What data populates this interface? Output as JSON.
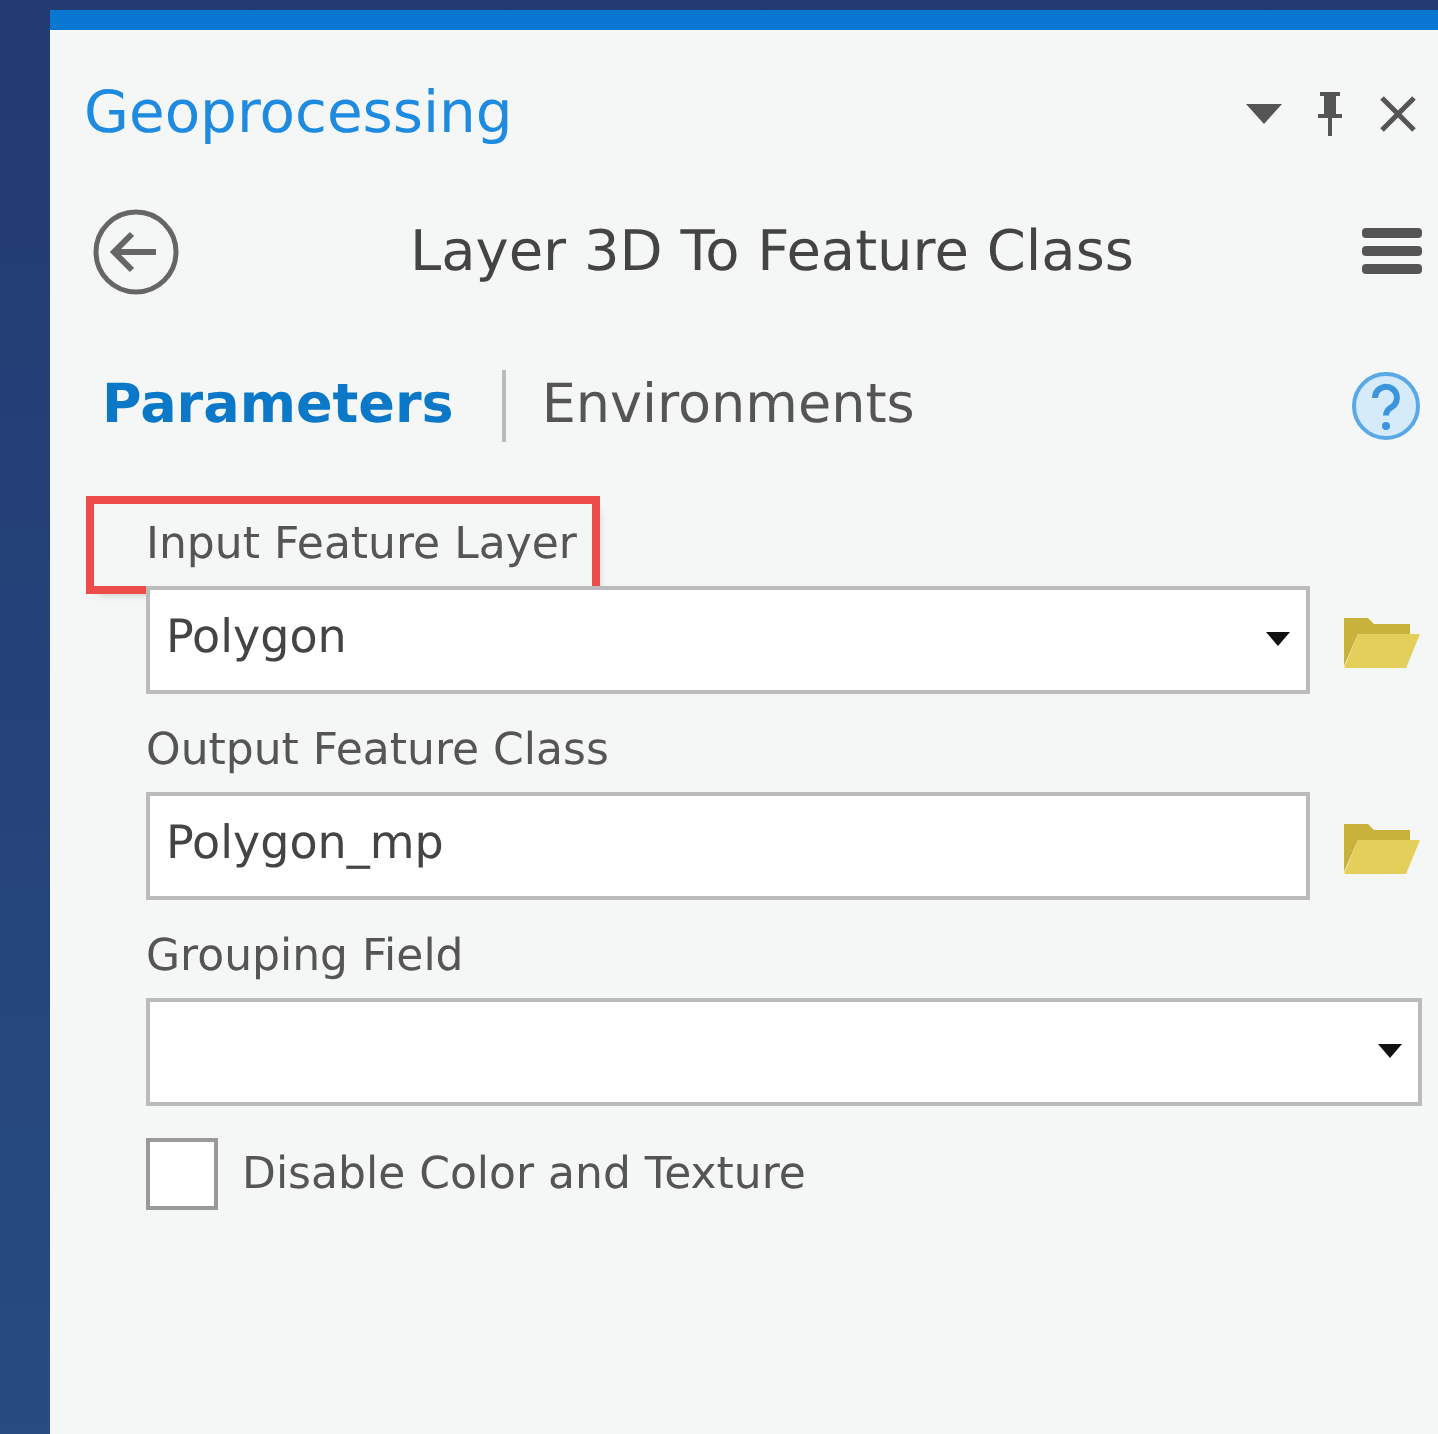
{
  "pane": {
    "title": "Geoprocessing"
  },
  "tool": {
    "title": "Layer 3D To Feature Class"
  },
  "tabs": [
    {
      "label": "Parameters",
      "selected": true
    },
    {
      "label": "Environments",
      "selected": false
    }
  ],
  "parameters": [
    {
      "kind": "dropdown",
      "label": "Input Feature Layer",
      "value": "Polygon",
      "highlighted": true,
      "browse": true
    },
    {
      "kind": "text",
      "label": "Output Feature Class",
      "value": "Polygon_mp",
      "highlighted": false,
      "browse": true
    },
    {
      "kind": "dropdown",
      "label": "Grouping Field",
      "highlighted": false,
      "browse": false
    },
    {
      "kind": "checkbox",
      "label": "Disable Color and Texture",
      "checked": false
    }
  ]
}
